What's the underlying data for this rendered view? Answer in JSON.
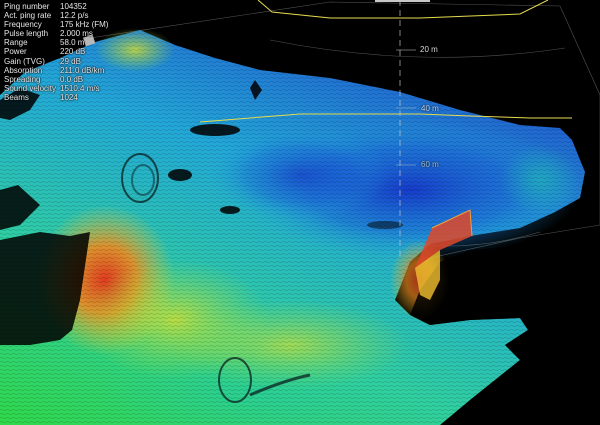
{
  "sonar_readout": [
    {
      "label": "Ping number",
      "value": "104352"
    },
    {
      "label": "Act. ping rate",
      "value": "12.2 p/s"
    },
    {
      "label": "Frequency",
      "value": "175 kHz (FM)"
    },
    {
      "label": "Pulse length",
      "value": "2.000 ms"
    },
    {
      "label": "Range",
      "value": "58.0 m"
    },
    {
      "label": "Power",
      "value": "220 dB"
    },
    {
      "label": "Gain (TVG)",
      "value": "29 dB"
    },
    {
      "label": "Absorption",
      "value": "211.0 dB/km"
    },
    {
      "label": "Spreading",
      "value": "0.0 dB"
    },
    {
      "label": "Sound velocity",
      "value": "1510.4 m/s"
    },
    {
      "label": "Beams",
      "value": "1024"
    }
  ],
  "range_rings": {
    "ring_20": "20 m",
    "ring_40": "40 m",
    "ring_60": "60 m"
  },
  "colors": {
    "background": "#000000",
    "overlay_text": "#e6e6e6",
    "swath_line": "#e6dc50",
    "depth_shallow": "#e0302a",
    "depth_mid": "#f0e030",
    "depth_deep": "#1a50d0"
  }
}
